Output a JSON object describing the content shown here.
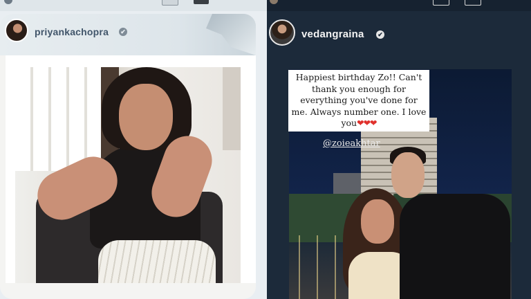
{
  "left_story": {
    "username": "priyankachopra",
    "verified_mark": "✔"
  },
  "right_story": {
    "username": "vedangraina",
    "verified_mark": "✔",
    "caption": "Happiest birthday Zo!! Can't thank you enough for everything you've done for me. Always number one. I love you",
    "caption_hearts": "❤❤❤",
    "mention": "@zoieakhtar"
  },
  "icons": [
    "avatar",
    "verified-badge-icon",
    "heart-icon"
  ],
  "colors": {
    "left_bg": "#e9eef2",
    "right_bg": "#1c2a3a",
    "heart": "#e0322d",
    "username_left": "#41556a"
  }
}
